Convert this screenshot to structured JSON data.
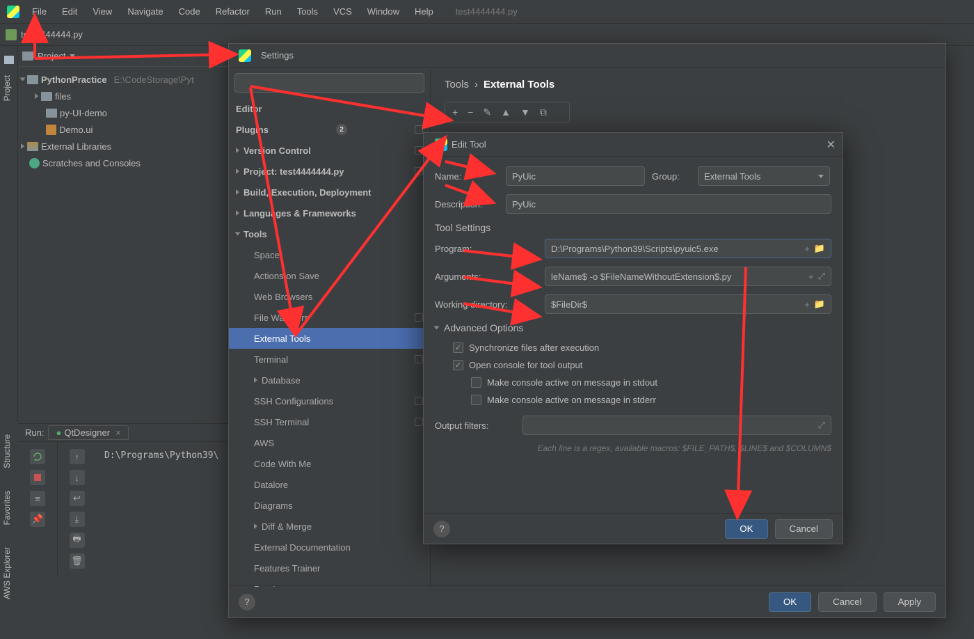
{
  "menubar": {
    "items": [
      "File",
      "Edit",
      "View",
      "Navigate",
      "Code",
      "Refactor",
      "Run",
      "Tools",
      "VCS",
      "Window",
      "Help"
    ],
    "dim_file": "test4444444.py"
  },
  "navbar": {
    "file": "test4444444.py"
  },
  "side_tabs": {
    "project": "Project",
    "structure": "Structure",
    "favorites": "Favorites",
    "aws": "AWS Explorer"
  },
  "project_tree": {
    "header": "Project",
    "root": "PythonPractice",
    "root_path": "E:\\CodeStorage\\Pyt",
    "items": [
      "files",
      "py-UI-demo",
      "Demo.ui",
      "External Libraries",
      "Scratches and Consoles"
    ]
  },
  "settings": {
    "title": "Settings",
    "breadcrumb": {
      "a": "Tools",
      "b": "External Tools"
    },
    "categories": {
      "editor": "Editor",
      "plugins": "Plugins",
      "plugins_badge": "2",
      "vc": "Version Control",
      "project": "Project: test4444444.py",
      "bed": "Build, Execution, Deployment",
      "langs": "Languages & Frameworks",
      "tools": "Tools",
      "sub": [
        "Space",
        "Actions on Save",
        "Web Browsers",
        "File Watchers",
        "External Tools",
        "Terminal",
        "Database",
        "SSH Configurations",
        "SSH Terminal",
        "AWS",
        "Code With Me",
        "Datalore",
        "Diagrams",
        "Diff & Merge",
        "External Documentation",
        "Features Trainer",
        "Pandoc"
      ]
    },
    "toolbar_icons": [
      "+",
      "−",
      "✎",
      "▲",
      "▼",
      "⧉"
    ],
    "buttons": {
      "ok": "OK",
      "cancel": "Cancel",
      "apply": "Apply"
    }
  },
  "edit_tool": {
    "title": "Edit Tool",
    "labels": {
      "name": "Name:",
      "group": "Group:",
      "description": "Description:",
      "tool_settings": "Tool Settings",
      "program": "Program:",
      "arguments": "Arguments:",
      "workdir": "Working directory:",
      "adv": "Advanced Options",
      "sync": "Synchronize files after execution",
      "console": "Open console for tool output",
      "stdout": "Make console active on message in stdout",
      "stderr": "Make console active on message in stderr",
      "outfilter": "Output filters:"
    },
    "values": {
      "name": "PyUic",
      "group": "External Tools",
      "description": "PyUic",
      "program": "D:\\Programs\\Python39\\Scripts\\pyuic5.exe",
      "arguments": "leName$ -o $FileNameWithoutExtension$.py",
      "workdir": "$FileDir$",
      "output_filters": ""
    },
    "hint": "Each line is a regex, available macros: $FILE_PATH$, $LINE$ and $COLUMN$",
    "ok": "OK",
    "cancel": "Cancel"
  },
  "run": {
    "label": "Run:",
    "tab": "QtDesigner",
    "output": "D:\\Programs\\Python39\\"
  }
}
